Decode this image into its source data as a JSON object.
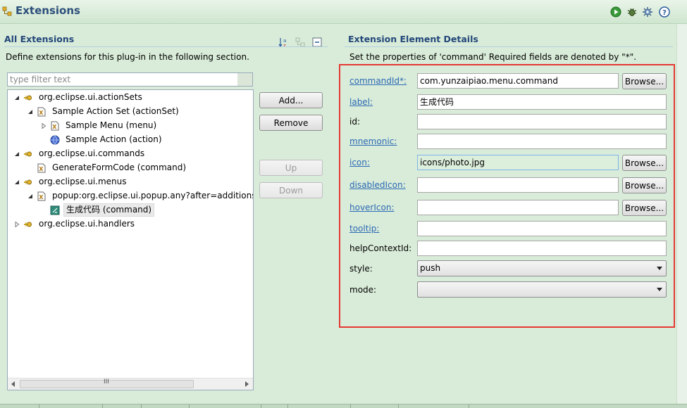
{
  "header": {
    "title": "Extensions",
    "toolbar_icons": [
      "run-icon",
      "debug-icon",
      "settings-icon",
      "help-icon"
    ]
  },
  "left": {
    "title": "All Extensions",
    "description": "Define extensions for this plug-in in the following section.",
    "filter_placeholder": "type filter text",
    "tree": [
      {
        "label": "org.eclipse.ui.actionSets",
        "expanded": true
      },
      {
        "label": "Sample Action Set (actionSet)",
        "expanded": true
      },
      {
        "label": "Sample Menu (menu)",
        "expanded": false
      },
      {
        "label": "Sample Action (action)"
      },
      {
        "label": "org.eclipse.ui.commands",
        "expanded": true
      },
      {
        "label": "GenerateFormCode (command)"
      },
      {
        "label": "org.eclipse.ui.menus",
        "expanded": true
      },
      {
        "label": "popup:org.eclipse.ui.popup.any?after=additions",
        "expanded": true
      },
      {
        "label": "生成代码 (command)",
        "selected": true
      },
      {
        "label": "org.eclipse.ui.handlers",
        "expanded": false
      }
    ],
    "scroll_thumb_label": "III",
    "buttons": {
      "add": "Add...",
      "remove": "Remove",
      "up": "Up",
      "down": "Down"
    }
  },
  "right": {
    "title": "Extension Element Details",
    "description": "Set the properties of 'command' Required fields are denoted by \"*\".",
    "browse_label": "Browse...",
    "fields": {
      "commandId": {
        "label": "commandId*:",
        "value": "com.yunzaipiao.menu.command"
      },
      "label": {
        "label": "label:",
        "value": "生成代码"
      },
      "id": {
        "label": "id:",
        "value": ""
      },
      "mnemonic": {
        "label": "mnemonic:",
        "value": ""
      },
      "icon": {
        "label": "icon:",
        "value": "icons/photo.jpg"
      },
      "disabledIcon": {
        "label": "disabledIcon:",
        "value": ""
      },
      "hoverIcon": {
        "label": "hoverIcon:",
        "value": ""
      },
      "tooltip": {
        "label": "tooltip:",
        "value": ""
      },
      "helpContextId": {
        "label": "helpContextId:",
        "value": ""
      },
      "style": {
        "label": "style:",
        "value": "push"
      },
      "mode": {
        "label": "mode:",
        "value": ""
      }
    }
  },
  "colors": {
    "background": "#d9ecd9",
    "section_title": "#23477a",
    "link": "#2c69b5",
    "highlight_box": "#e53935"
  }
}
